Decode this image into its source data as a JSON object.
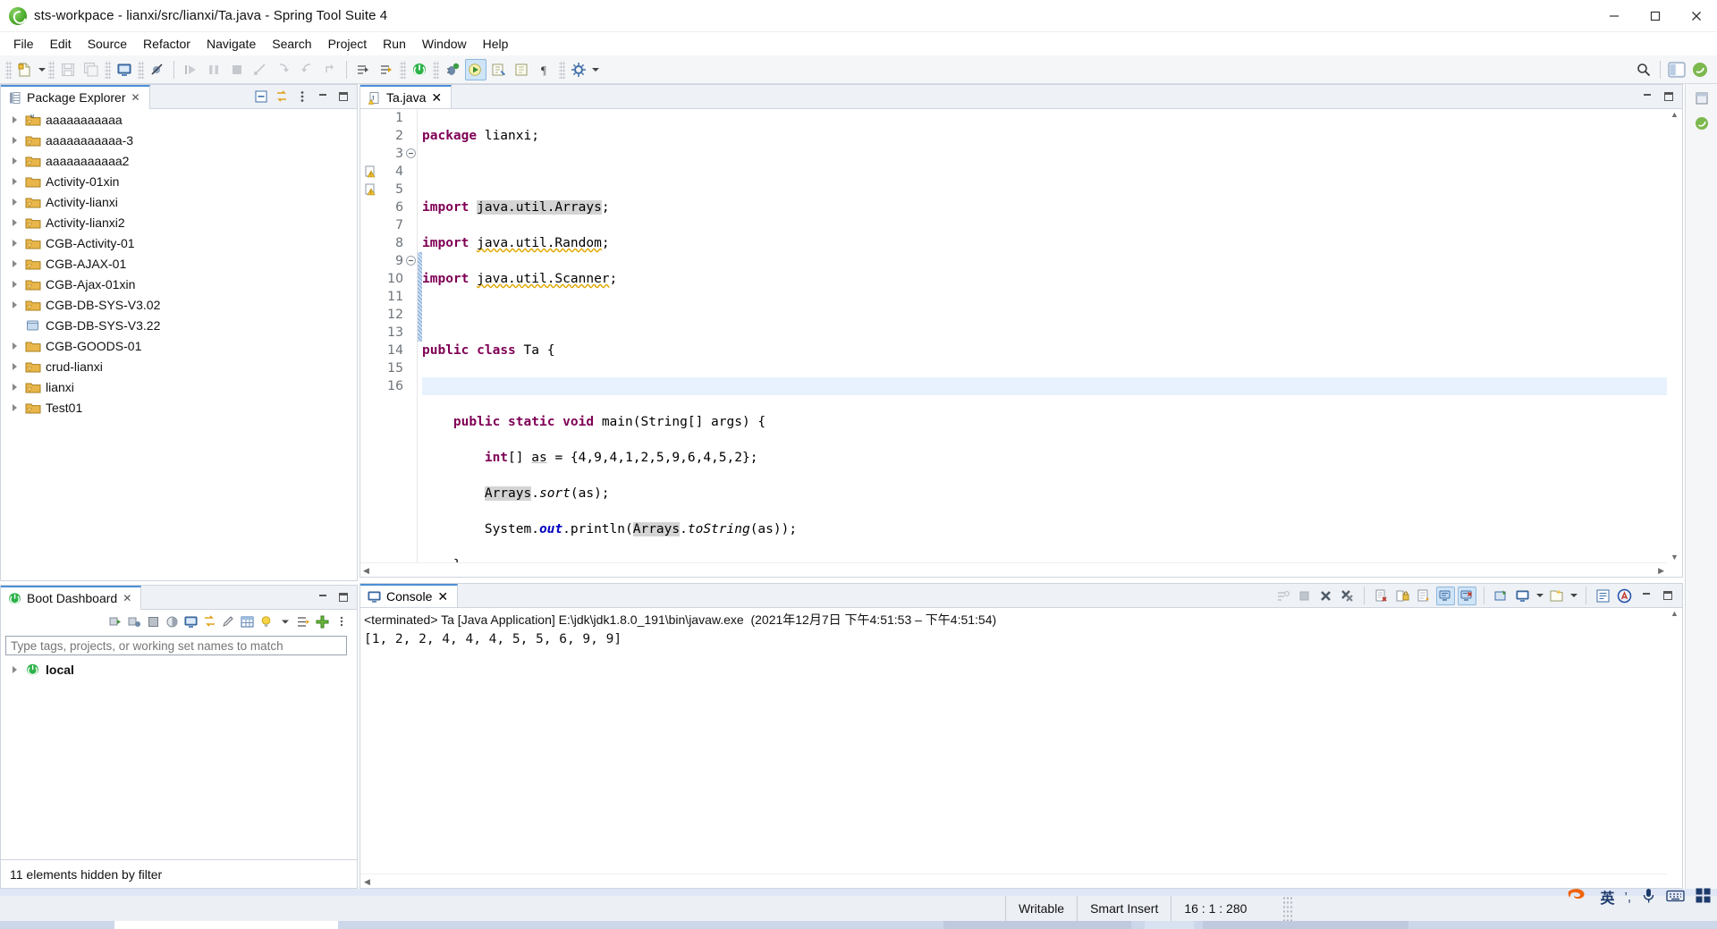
{
  "window": {
    "title": "sts-workpace - lianxi/src/lianxi/Ta.java - Spring Tool Suite 4",
    "app_icon": "sts-leaf-icon",
    "minimize_label": "Minimize",
    "maximize_label": "Maximize",
    "close_label": "Close"
  },
  "menubar": {
    "items": [
      {
        "label": "File"
      },
      {
        "label": "Edit"
      },
      {
        "label": "Source"
      },
      {
        "label": "Refactor"
      },
      {
        "label": "Navigate"
      },
      {
        "label": "Search"
      },
      {
        "label": "Project"
      },
      {
        "label": "Run"
      },
      {
        "label": "Window"
      },
      {
        "label": "Help"
      }
    ]
  },
  "toolbar": {
    "buttons": [
      {
        "name": "new-wizard",
        "icon": "new-file-icon",
        "enabled": true
      },
      {
        "name": "save",
        "icon": "save-icon",
        "enabled": false
      },
      {
        "name": "save-all",
        "icon": "save-all-icon",
        "enabled": false
      },
      {
        "name": "open-console",
        "icon": "console-icon",
        "enabled": true
      },
      {
        "name": "skip-breakpoints",
        "icon": "skip-breakpoints-icon",
        "enabled": true
      },
      {
        "name": "resume",
        "icon": "resume-icon",
        "enabled": false
      },
      {
        "name": "suspend",
        "icon": "suspend-icon",
        "enabled": false
      },
      {
        "name": "terminate",
        "icon": "terminate-icon",
        "enabled": false
      },
      {
        "name": "disconnect",
        "icon": "disconnect-icon",
        "enabled": false
      },
      {
        "name": "step-into",
        "icon": "step-into-icon",
        "enabled": false
      },
      {
        "name": "step-over",
        "icon": "step-over-icon",
        "enabled": false
      },
      {
        "name": "step-return",
        "icon": "step-return-icon",
        "enabled": false
      },
      {
        "name": "next-annotation",
        "icon": "next-annotation-icon",
        "enabled": true
      },
      {
        "name": "previous-annotation",
        "icon": "previous-annotation-icon",
        "enabled": true
      },
      {
        "name": "boot-dashboard",
        "icon": "boot-power-icon",
        "enabled": true
      },
      {
        "name": "debug",
        "icon": "debug-bug-icon",
        "enabled": true
      },
      {
        "name": "run",
        "icon": "run-play-icon",
        "enabled": true
      },
      {
        "name": "external-tools",
        "icon": "external-tools-icon",
        "enabled": true
      },
      {
        "name": "new-java-project",
        "icon": "java-project-icon",
        "enabled": true
      },
      {
        "name": "new-java-package",
        "icon": "package-icon",
        "enabled": true
      },
      {
        "name": "new-class",
        "icon": "new-class-icon",
        "enabled": true
      },
      {
        "name": "pilcrow",
        "icon": "pilcrow-icon",
        "enabled": true
      },
      {
        "name": "search-global",
        "icon": "search-icon",
        "enabled": true
      },
      {
        "name": "open-perspective",
        "icon": "open-perspective-icon",
        "enabled": true
      },
      {
        "name": "java-perspective",
        "icon": "java-perspective-icon",
        "enabled": true
      },
      {
        "name": "spring-perspective",
        "icon": "spring-perspective-icon",
        "enabled": true
      }
    ]
  },
  "package_explorer": {
    "title": "Package Explorer",
    "close_label": "✕",
    "tools": [
      {
        "name": "collapse-all",
        "icon": "collapse-all-icon"
      },
      {
        "name": "link-with-editor",
        "icon": "link-editor-icon"
      },
      {
        "name": "view-menu",
        "icon": "view-menu-icon"
      },
      {
        "name": "minimize",
        "icon": "minimize-icon"
      },
      {
        "name": "maximize",
        "icon": "maximize-icon"
      }
    ],
    "items": [
      {
        "label": "aaaaaaaaaaa",
        "icon": "maven-java-project-warning-icon",
        "expandable": true
      },
      {
        "label": "aaaaaaaaaaa-3",
        "icon": "maven-java-project-warning-icon",
        "expandable": true
      },
      {
        "label": "aaaaaaaaaaa2",
        "icon": "maven-java-project-warning-icon",
        "expandable": true
      },
      {
        "label": "Activity-01xin",
        "icon": "maven-java-project-icon",
        "expandable": true
      },
      {
        "label": "Activity-lianxi",
        "icon": "maven-java-project-warning-icon",
        "expandable": true
      },
      {
        "label": "Activity-lianxi2",
        "icon": "maven-java-project-warning-icon",
        "expandable": true
      },
      {
        "label": "CGB-Activity-01",
        "icon": "maven-java-project-warning-icon",
        "expandable": true
      },
      {
        "label": "CGB-AJAX-01",
        "icon": "maven-java-project-warning-icon",
        "expandable": true
      },
      {
        "label": "CGB-Ajax-01xin",
        "icon": "maven-java-project-warning-icon",
        "expandable": true
      },
      {
        "label": "CGB-DB-SYS-V3.02",
        "icon": "maven-java-project-warning-icon",
        "expandable": true
      },
      {
        "label": "CGB-DB-SYS-V3.22",
        "icon": "closed-project-icon",
        "expandable": false
      },
      {
        "label": "CGB-GOODS-01",
        "icon": "maven-java-project-icon",
        "expandable": true
      },
      {
        "label": "crud-lianxi",
        "icon": "maven-java-project-warning-icon",
        "expandable": true
      },
      {
        "label": "lianxi",
        "icon": "maven-java-project-warning-icon",
        "expandable": true
      },
      {
        "label": "Test01",
        "icon": "maven-java-project-warning-icon",
        "expandable": true
      }
    ]
  },
  "boot_dashboard": {
    "title": "Boot Dashboard",
    "close_label": "✕",
    "tools": [
      {
        "name": "start",
        "icon": "start-icon"
      },
      {
        "name": "debug-start",
        "icon": "debug-start-icon"
      },
      {
        "name": "stop",
        "icon": "stop-icon"
      },
      {
        "name": "restart",
        "icon": "restart-icon"
      },
      {
        "name": "open-console",
        "icon": "console-icon"
      },
      {
        "name": "open-browser",
        "icon": "open-browser-icon"
      },
      {
        "name": "edit",
        "icon": "pencil-icon"
      },
      {
        "name": "properties",
        "icon": "table-icon"
      },
      {
        "name": "live-beans",
        "icon": "lightbulb-icon"
      },
      {
        "name": "dropdown",
        "icon": "chevron-down-icon"
      },
      {
        "name": "filter-tags",
        "icon": "filter-icon"
      },
      {
        "name": "add",
        "icon": "plus-icon"
      },
      {
        "name": "view-menu",
        "icon": "view-menu-icon"
      }
    ],
    "filter_placeholder": "Type tags, projects, or working set names to match",
    "filter_value": "",
    "tree": [
      {
        "label": "local",
        "icon": "boot-power-icon",
        "expandable": true,
        "bold": true
      }
    ],
    "minimize_label": "Minimize",
    "maximize_label": "Maximize"
  },
  "left_status": {
    "text": "11 elements hidden by filter"
  },
  "editor": {
    "tab_label": "Ta.java",
    "tab_icon": "java-file-warning-icon",
    "close_label": "✕",
    "tools": [
      {
        "name": "minimize",
        "icon": "minimize-icon"
      },
      {
        "name": "maximize",
        "icon": "maximize-icon"
      }
    ],
    "lines": [
      {
        "n": "1",
        "fold": "",
        "ann": "",
        "text": "package lianxi;"
      },
      {
        "n": "2",
        "fold": "",
        "ann": "",
        "text": ""
      },
      {
        "n": "3",
        "fold": "minus",
        "ann": "",
        "text": "import java.util.Arrays;"
      },
      {
        "n": "4",
        "fold": "",
        "ann": "warning",
        "text": "import java.util.Random;"
      },
      {
        "n": "5",
        "fold": "",
        "ann": "warning",
        "text": "import java.util.Scanner;"
      },
      {
        "n": "6",
        "fold": "",
        "ann": "",
        "text": ""
      },
      {
        "n": "7",
        "fold": "",
        "ann": "",
        "text": "public class Ta {"
      },
      {
        "n": "8",
        "fold": "",
        "ann": "",
        "text": ""
      },
      {
        "n": "9",
        "fold": "minus",
        "ann": "",
        "text": "    public static void main(String[] args) {"
      },
      {
        "n": "10",
        "fold": "",
        "ann": "",
        "text": "        int[] as = {4,9,4,1,2,5,9,6,4,5,2};"
      },
      {
        "n": "11",
        "fold": "",
        "ann": "",
        "text": "        Arrays.sort(as);"
      },
      {
        "n": "12",
        "fold": "",
        "ann": "",
        "text": "        System.out.println(Arrays.toString(as));"
      },
      {
        "n": "13",
        "fold": "",
        "ann": "",
        "text": "    }"
      },
      {
        "n": "14",
        "fold": "",
        "ann": "",
        "text": ""
      },
      {
        "n": "15",
        "fold": "",
        "ann": "",
        "text": "}"
      },
      {
        "n": "16",
        "fold": "",
        "ann": "",
        "text": ""
      }
    ],
    "caret_line": 16
  },
  "console": {
    "title": "Console",
    "close_label": "✕",
    "tools": [
      {
        "name": "terminate-all",
        "icon": "terminate-all-icon"
      },
      {
        "name": "terminate",
        "icon": "terminate-icon"
      },
      {
        "name": "remove-launch",
        "icon": "remove-icon"
      },
      {
        "name": "remove-all-terminated",
        "icon": "remove-all-icon"
      },
      {
        "name": "clear-console",
        "icon": "clear-console-icon"
      },
      {
        "name": "scroll-lock",
        "icon": "scroll-lock-icon"
      },
      {
        "name": "word-wrap",
        "icon": "word-wrap-icon"
      },
      {
        "name": "show-console-on-output",
        "icon": "show-output-icon",
        "selected": true
      },
      {
        "name": "show-console-on-error",
        "icon": "show-error-icon",
        "selected": true
      },
      {
        "name": "pin-console",
        "icon": "pin-console-icon"
      },
      {
        "name": "display-selected-console",
        "icon": "display-console-icon"
      },
      {
        "name": "display-console-dropdown",
        "icon": "chevron-down-icon"
      },
      {
        "name": "open-console",
        "icon": "new-console-icon"
      },
      {
        "name": "open-console-dropdown",
        "icon": "chevron-down-icon"
      },
      {
        "name": "view-menu",
        "icon": "view-menu-icon"
      },
      {
        "name": "annotations",
        "icon": "annotations-icon"
      },
      {
        "name": "minimize",
        "icon": "minimize-icon"
      },
      {
        "name": "maximize",
        "icon": "maximize-icon"
      }
    ],
    "header": "<terminated> Ta [Java Application] E:\\jdk\\jdk1.8.0_191\\bin\\javaw.exe  (2021年12月7日 下午4:51:53 – 下午4:51:54)",
    "output": "[1, 2, 2, 4, 4, 4, 5, 5, 6, 9, 9]"
  },
  "right_rail": {
    "buttons": [
      {
        "name": "restore-perspective",
        "icon": "restore-icon"
      },
      {
        "name": "spring-boot-view",
        "icon": "spring-icon"
      }
    ]
  },
  "statusbar": {
    "writable": "Writable",
    "insert_mode": "Smart Insert",
    "position": "16 : 1 : 280",
    "ime": {
      "logo": "sogou-ime-icon",
      "mode": "英",
      "punctuation": "’,",
      "mic": "mic-icon",
      "keyboard": "keyboard-icon",
      "toolbox": "toolbox-icon"
    }
  },
  "colors": {
    "accent": "#4c8fd6",
    "keyword": "#7f0055",
    "field": "#0000c0",
    "highlight": "#d4d4d4",
    "current_line": "#e8f2fe",
    "panel_bg": "#eef1f6",
    "border": "#cfd5dd",
    "statusbar_bg": "#dfe6f5"
  }
}
